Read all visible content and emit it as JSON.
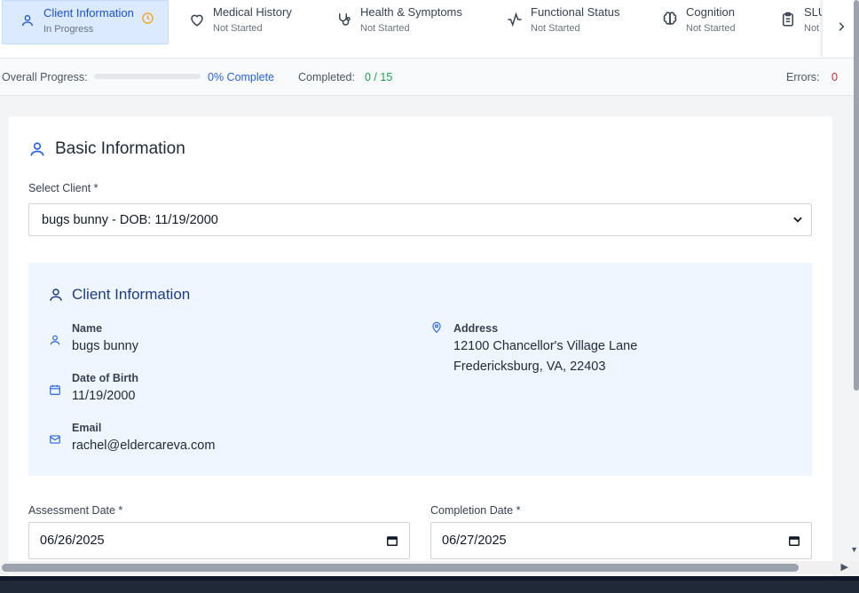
{
  "tabs": [
    {
      "name": "Client Information",
      "status": "In Progress",
      "icon": "user-icon",
      "active": true
    },
    {
      "name": "Medical History",
      "status": "Not Started",
      "icon": "heart-icon"
    },
    {
      "name": "Health & Symptoms",
      "status": "Not Started",
      "icon": "stethoscope-icon"
    },
    {
      "name": "Functional Status",
      "status": "Not Started",
      "icon": "activity-icon"
    },
    {
      "name": "Cognition",
      "status": "Not Started",
      "icon": "brain-icon"
    },
    {
      "name": "SLU",
      "status": "Not",
      "icon": "clipboard-icon"
    }
  ],
  "progress": {
    "overall_label": "Overall Progress:",
    "percent_value": 0,
    "percent_text": "0% Complete",
    "completed_label": "Completed:",
    "completed_value": "0 / 15",
    "errors_label": "Errors:",
    "errors_value": "0"
  },
  "basic_info": {
    "title": "Basic Information",
    "select_client_label": "Select Client *",
    "selected_client": "bugs bunny - DOB: 11/19/2000"
  },
  "client_info": {
    "title": "Client Information",
    "name_label": "Name",
    "name": "bugs bunny",
    "dob_label": "Date of Birth",
    "dob": "11/19/2000",
    "email_label": "Email",
    "email": "rachel@eldercareva.com",
    "address_label": "Address",
    "address_line1": "12100 Chancellor's Village Lane",
    "address_line2": "Fredericksburg, VA, 22403"
  },
  "dates": {
    "assessment_label": "Assessment Date *",
    "assessment_value": "06/26/2025",
    "completion_label": "Completion Date *",
    "completion_value": "06/27/2025"
  },
  "colors": {
    "accent": "#2563eb",
    "in_progress": "#f59e0b",
    "success": "#16a34a",
    "error": "#dc2626",
    "info_bg": "#eff6ff"
  }
}
